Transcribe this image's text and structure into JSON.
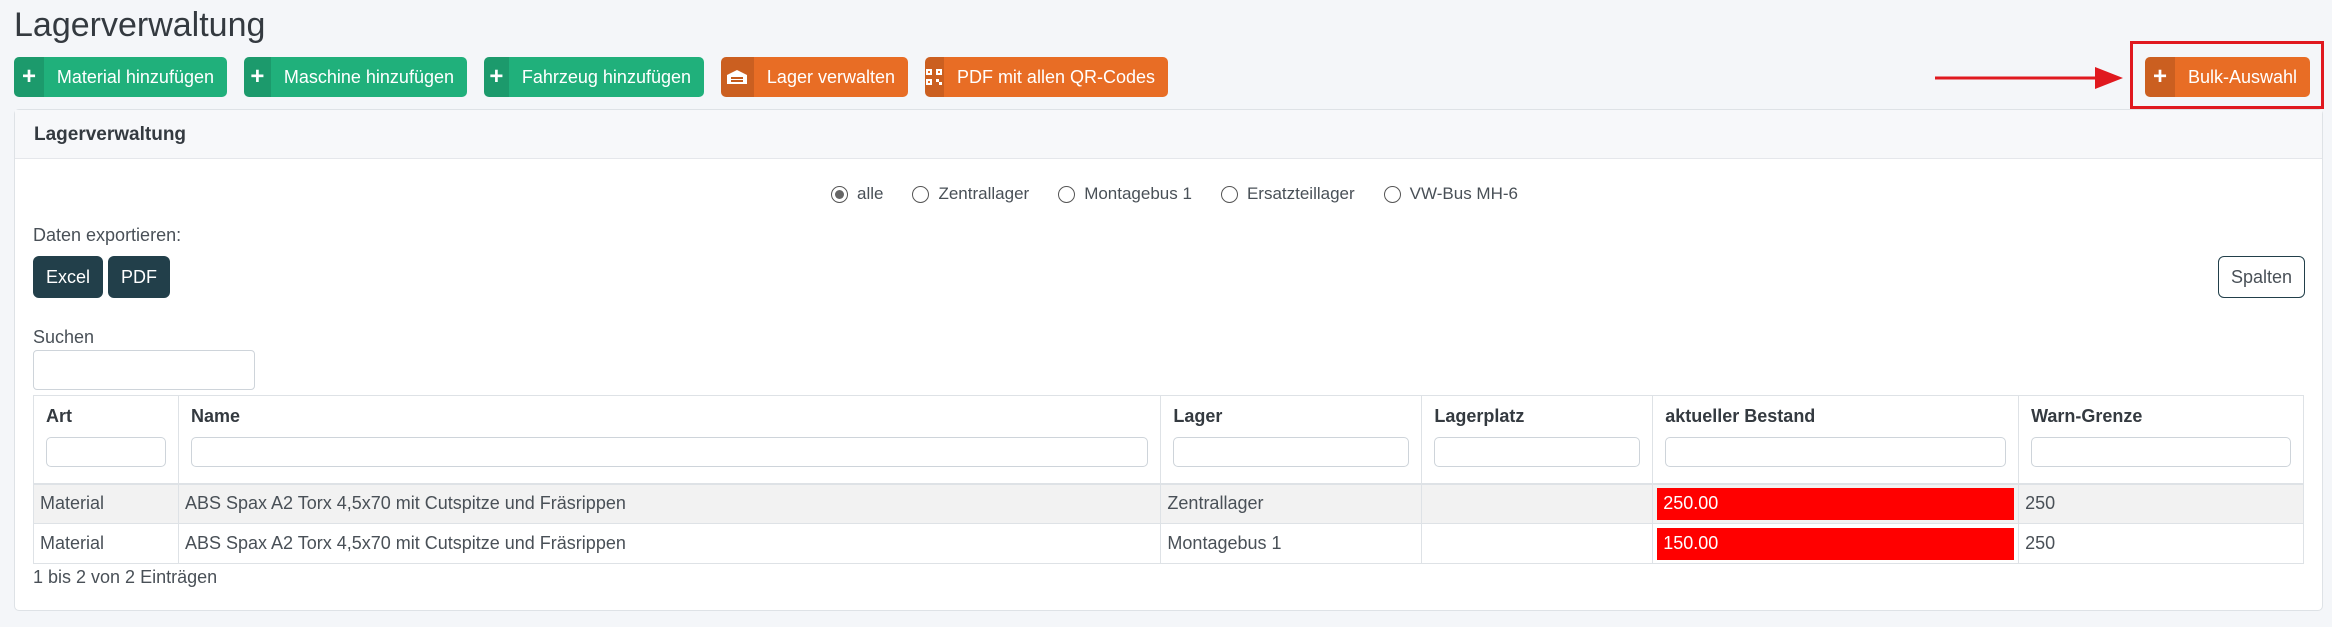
{
  "page": {
    "title": "Lagerverwaltung"
  },
  "toolbar": {
    "material": "Material hinzufügen",
    "maschine": "Maschine hinzufügen",
    "fahrzeug": "Fahrzeug hinzufügen",
    "lager": "Lager verwalten",
    "pdf": "PDF mit allen QR-Codes",
    "bulk": "Bulk-Auswahl"
  },
  "card": {
    "title": "Lagerverwaltung"
  },
  "filters": {
    "options": [
      "alle",
      "Zentrallager",
      "Montagebus 1",
      "Ersatzteillager",
      "VW-Bus MH-6"
    ],
    "selected": "alle"
  },
  "export": {
    "label": "Daten exportieren:",
    "excel": "Excel",
    "pdf": "PDF",
    "columns": "Spalten"
  },
  "search": {
    "label": "Suchen",
    "value": ""
  },
  "table": {
    "headers": [
      "Art",
      "Name",
      "Lager",
      "Lagerplatz",
      "aktueller Bestand",
      "Warn-Grenze"
    ],
    "rows": [
      [
        "Material",
        "ABS Spax A2 Torx 4,5x70 mit Cutspitze und Fräsrippen",
        "Zentrallager",
        "",
        "250.00",
        "250"
      ],
      [
        "Material",
        "ABS Spax A2 Torx 4,5x70 mit Cutspitze und Fräsrippen",
        "Montagebus 1",
        "",
        "150.00",
        "250"
      ]
    ],
    "info": "1 bis 2 von 2 Einträgen"
  },
  "colors": {
    "green": "#20b07b",
    "orange": "#e86d25",
    "dark": "#223f4a",
    "warning": "#ff0000",
    "highlight": "#e0191f"
  },
  "icons": {
    "add": "plus-icon",
    "warehouse": "warehouse-icon",
    "qr": "qr-code-icon",
    "annotation": "red-arrow"
  }
}
